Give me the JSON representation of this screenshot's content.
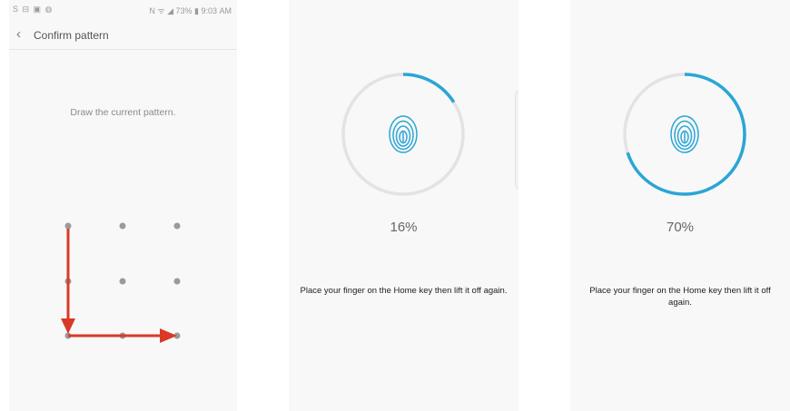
{
  "statusbar": {
    "left_icons": "S ⊟ ▣ ◍",
    "right_text": "N ᯤ ◢ 73% ▮ 9:03 AM"
  },
  "confirm": {
    "title": "Confirm pattern",
    "instruction": "Draw the current pattern.",
    "pattern_dots": 9,
    "drawn_pattern_order": [
      1,
      4,
      7,
      8,
      9
    ]
  },
  "scan_screens": [
    {
      "percent": "16%",
      "progress": 0.16,
      "message": "Place your finger on the Home key then lift it off again."
    },
    {
      "percent": "70%",
      "progress": 0.7,
      "message": "Place your finger on the Home key then lift it off again."
    }
  ],
  "colors": {
    "accent": "#2aa6d6",
    "ring_track": "#e3e3e3",
    "arrow": "#d93a27",
    "dot": "#9a9a9a"
  },
  "icons": {
    "fingerprint": "fingerprint-icon",
    "back": "chevron-left-icon"
  }
}
